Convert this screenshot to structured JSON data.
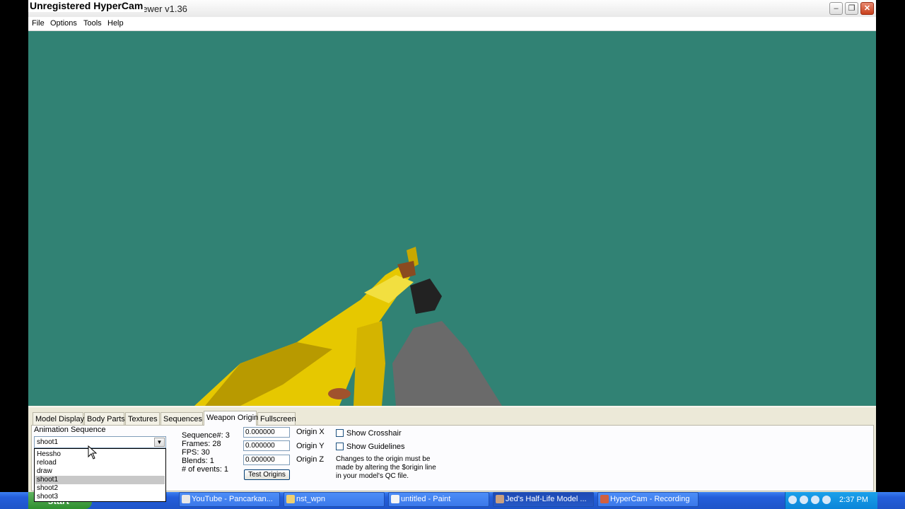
{
  "watermark": "Unregistered HyperCam",
  "window": {
    "title": "Jed's Half-Life Model Viewer v1.36",
    "visible_title_part": "Viewer v1.36",
    "controls": {
      "minimize": "–",
      "maximize": "❐",
      "close": "✕"
    }
  },
  "menu": [
    "File",
    "Options",
    "Tools",
    "Help"
  ],
  "colors": {
    "viewport_bg": "#318274",
    "panel_bg": "#ece9d8",
    "taskbar": "#245edb",
    "weapon_gold": "#e6c800"
  },
  "tabs": [
    "Model Display",
    "Body Parts",
    "Textures",
    "Sequences",
    "Weapon Origin",
    "Fullscreen"
  ],
  "active_tab": "Weapon Origin",
  "animation": {
    "label": "Animation Sequence",
    "selected": "shoot1",
    "options": [
      "Hessho",
      "reload",
      "draw",
      "shoot1",
      "shoot2",
      "shoot3"
    ]
  },
  "sequence_info": {
    "sequence": "Sequence#: 3",
    "frames": "Frames: 28",
    "fps": "FPS: 30",
    "blends": "Blends: 1",
    "events": "# of events: 1"
  },
  "origin": {
    "x_value": "0.000000",
    "y_value": "0.000000",
    "z_value": "0.000000",
    "x_label": "Origin X",
    "y_label": "Origin Y",
    "z_label": "Origin Z",
    "test_button": "Test Origins"
  },
  "options": {
    "show_crosshair": "Show Crosshair",
    "show_guidelines": "Show Guidelines",
    "note_line1": "Changes to the origin must be",
    "note_line2": "made by altering the $origin line",
    "note_line3": "in your model's QC file."
  },
  "taskbar": {
    "start": "start",
    "tasks": [
      "YouTube - Pancarkan...",
      "nst_wpn",
      "untitled - Paint",
      "Jed's Half-Life Model ...",
      "HyperCam - Recording"
    ],
    "clock": "2:37 PM"
  }
}
